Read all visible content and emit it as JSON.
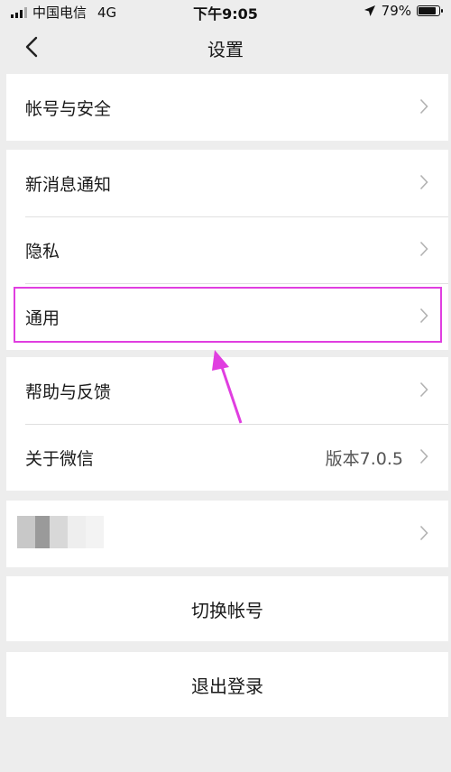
{
  "status_bar": {
    "carrier": "中国电信",
    "network": "4G",
    "time": "下午9:05",
    "battery": "79%"
  },
  "nav": {
    "title": "设置"
  },
  "groups": {
    "account": {
      "label": "帐号与安全"
    },
    "notify": {
      "label": "新消息通知"
    },
    "privacy": {
      "label": "隐私"
    },
    "general": {
      "label": "通用"
    },
    "help": {
      "label": "帮助与反馈"
    },
    "about": {
      "label": "关于微信",
      "value": "版本7.0.5"
    }
  },
  "switch_account": {
    "label": "切换帐号"
  },
  "logout": {
    "label": "退出登录"
  },
  "colors": {
    "highlight": "#e03ee0",
    "background": "#ededed"
  }
}
